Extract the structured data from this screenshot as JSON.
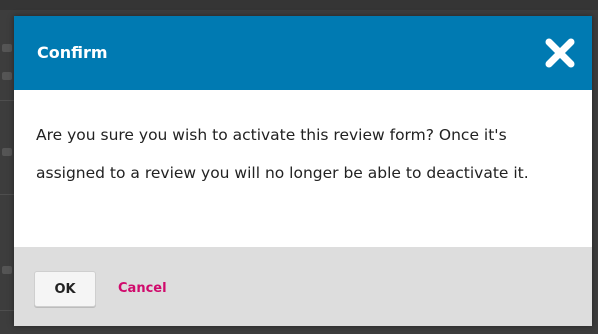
{
  "dialog": {
    "title": "Confirm",
    "message": "Are you sure you wish to activate this review form? Once it's assigned to a review you will no longer be able to deactivate it.",
    "close_icon": "close-icon",
    "ok_label": "OK",
    "cancel_label": "Cancel"
  },
  "colors": {
    "header_bg": "#007ab2",
    "header_text": "#ffffff",
    "footer_bg": "#dddddd",
    "cancel_link": "#d00a6c",
    "overlay": "#353535"
  }
}
